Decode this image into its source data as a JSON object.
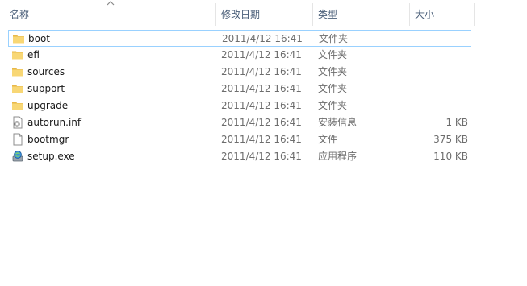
{
  "columns": {
    "name": "名称",
    "date_modified": "修改日期",
    "type": "类型",
    "size": "大小"
  },
  "sort": {
    "column": "name",
    "direction": "ascending",
    "icon": "sort-up-arrow-icon"
  },
  "colors": {
    "folder": "#f8d775",
    "folder_dark": "#e8b84a",
    "focus_border": "#99d1ff",
    "header_text": "#4c607a",
    "secondary_text": "#6d6d6d"
  },
  "files": [
    {
      "name": "boot",
      "date": "2011/4/12 16:41",
      "type": "文件夹",
      "size": "",
      "icon": "folder-icon",
      "focused": true
    },
    {
      "name": "efi",
      "date": "2011/4/12 16:41",
      "type": "文件夹",
      "size": "",
      "icon": "folder-icon"
    },
    {
      "name": "sources",
      "date": "2011/4/12 16:41",
      "type": "文件夹",
      "size": "",
      "icon": "folder-icon"
    },
    {
      "name": "support",
      "date": "2011/4/12 16:41",
      "type": "文件夹",
      "size": "",
      "icon": "folder-icon"
    },
    {
      "name": "upgrade",
      "date": "2011/4/12 16:41",
      "type": "文件夹",
      "size": "",
      "icon": "folder-icon"
    },
    {
      "name": "autorun.inf",
      "date": "2011/4/12 16:41",
      "type": "安装信息",
      "size": "1 KB",
      "icon": "settings-file-icon"
    },
    {
      "name": "bootmgr",
      "date": "2011/4/12 16:41",
      "type": "文件",
      "size": "375 KB",
      "icon": "blank-file-icon"
    },
    {
      "name": "setup.exe",
      "date": "2011/4/12 16:41",
      "type": "应用程序",
      "size": "110 KB",
      "icon": "setup-app-icon"
    }
  ]
}
